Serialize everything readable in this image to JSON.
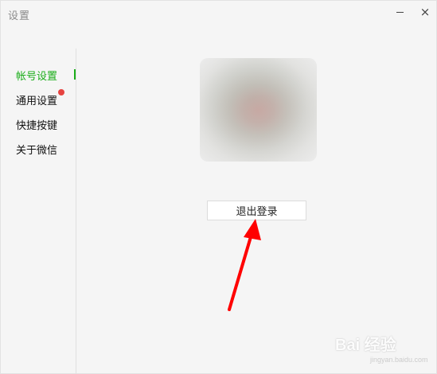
{
  "window": {
    "title": "设置",
    "minimize_icon": "minimize-icon",
    "close_icon": "close-icon",
    "close_glyph": "×"
  },
  "sidebar": {
    "items": [
      {
        "label": "帐号设置",
        "active": true
      },
      {
        "label": "通用设置",
        "badge": "red-dot"
      },
      {
        "label": "快捷按键"
      },
      {
        "label": "关于微信"
      }
    ],
    "accent_color": "#1aad19",
    "badge_color": "#e64340"
  },
  "main": {
    "avatar": "blurred-avatar-image",
    "logout_label": "退出登录"
  },
  "annotation": {
    "arrow_color": "#ff0000"
  },
  "watermark": {
    "text": "Bai 经验",
    "subtext": "jingyan.baidu.com"
  }
}
